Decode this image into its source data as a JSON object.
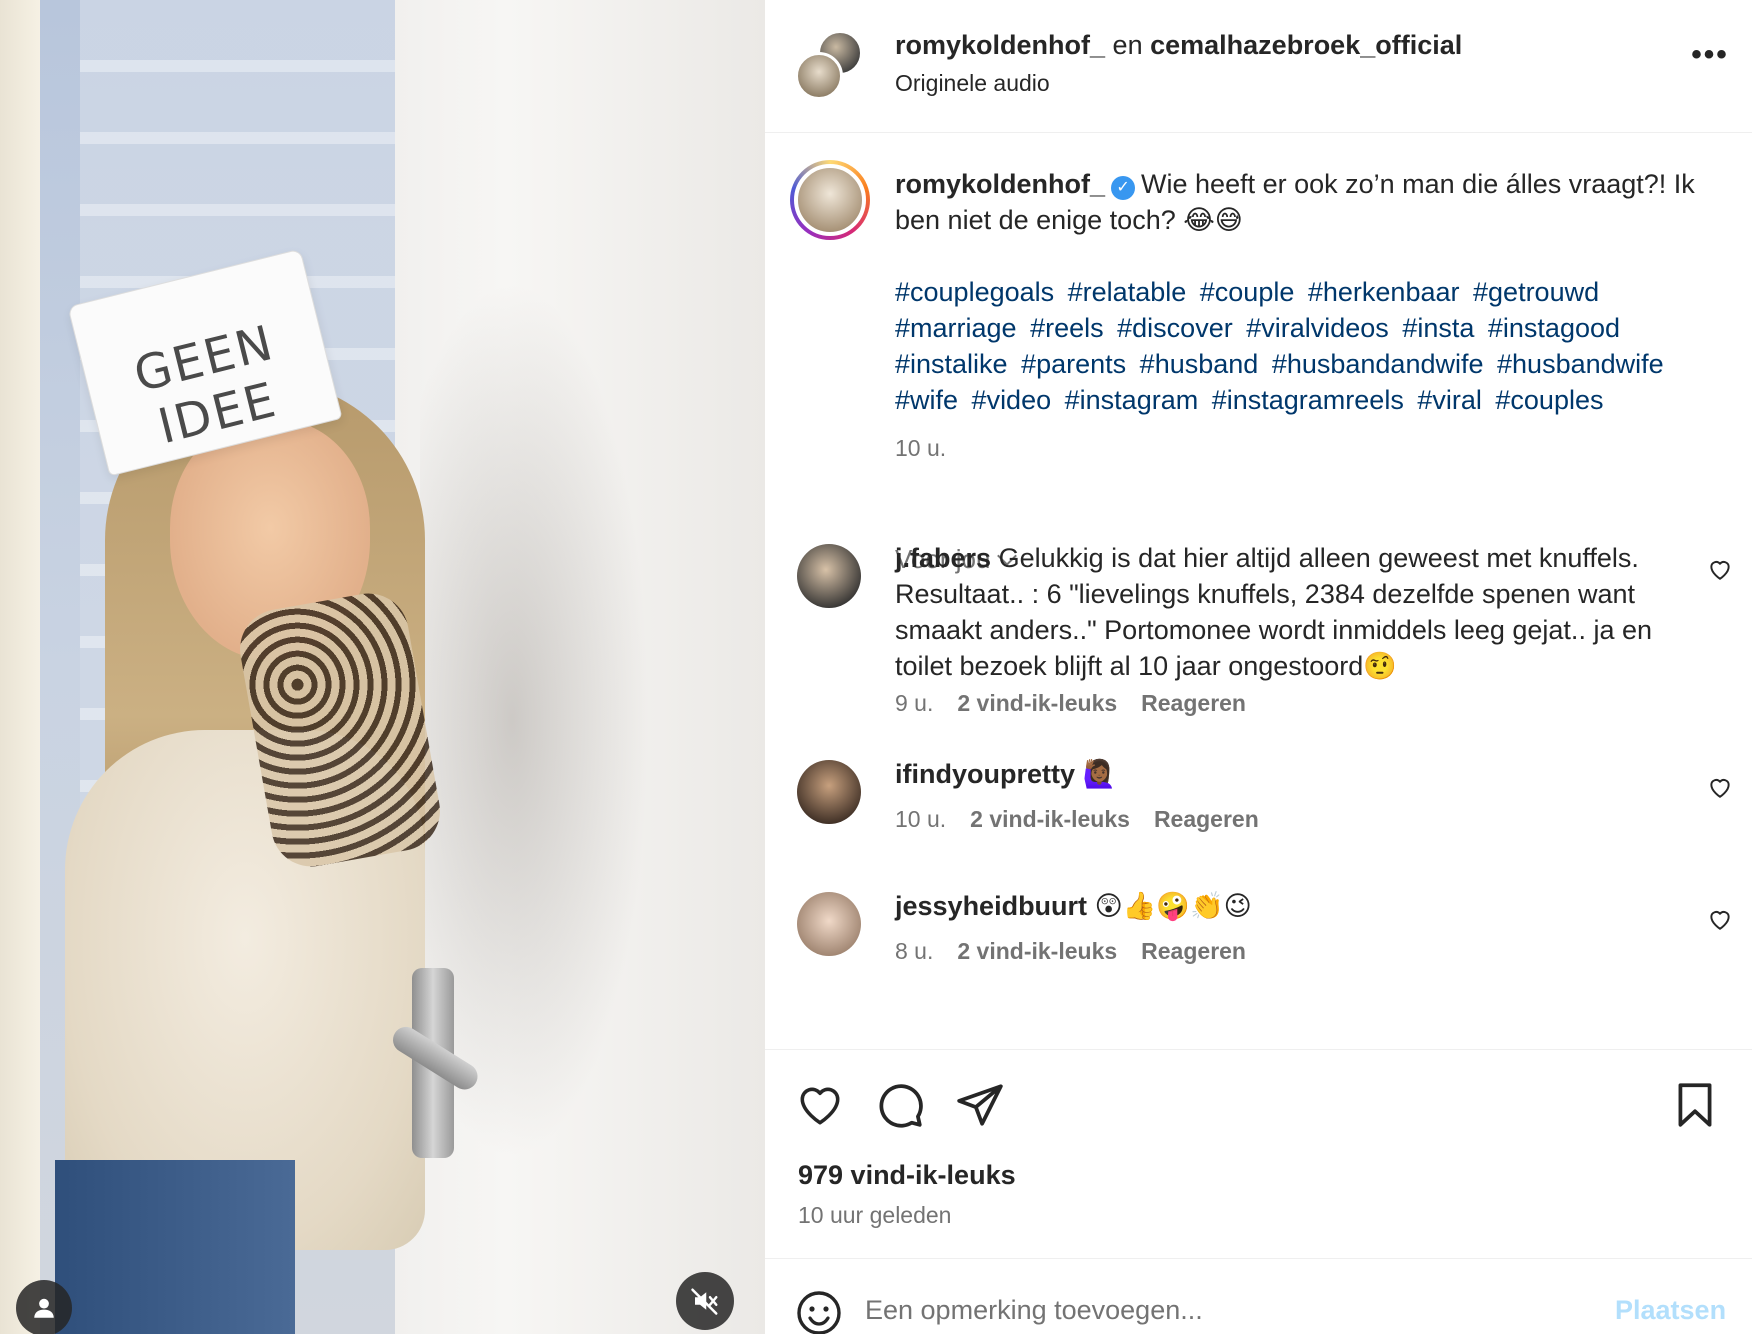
{
  "media": {
    "hat_text": "GEEN IDEE"
  },
  "header": {
    "user1": "romykoldenhof_",
    "separator": "en",
    "user2": "cemalhazebroek_official",
    "audio": "Originele audio",
    "more_label": "•••"
  },
  "caption": {
    "username": "romykoldenhof_",
    "verified_mark": "✓",
    "text": "Wie heeft er ook zo’n man die álles vraagt?! Ik ben niet de enige toch? 😂😅",
    "hashtags": [
      "#couplegoals",
      "#relatable",
      "#couple",
      "#herkenbaar",
      "#getrouwd",
      "#marriage",
      "#reels",
      "#discover",
      "#viralvideos",
      "#insta",
      "#instagood",
      "#instalike",
      "#parents",
      "#husband",
      "#husbandandwife",
      "#husbandwife",
      "#wife",
      "#video",
      "#instagram",
      "#instagramreels",
      "#viral",
      "#couples"
    ],
    "time": "10 u."
  },
  "sort_label": "Voor jou",
  "comments": [
    {
      "username": "j.fabers",
      "text": "Gelukkig is dat hier altijd alleen geweest met knuffels. Resultaat.. : 6 \"lievelings knuffels, 2384 dezelfde spenen want smaakt anders..\" Portomonee wordt inmiddels leeg gejat.. ja en toilet bezoek blijft al 10 jaar ongestoord🤨",
      "time": "9 u.",
      "likes": "2 vind-ik-leuks",
      "reply": "Reageren"
    },
    {
      "username": "ifindyoupretty",
      "text": "🙋🏾‍♀️",
      "time": "10 u.",
      "likes": "2 vind-ik-leuks",
      "reply": "Reageren"
    },
    {
      "username": "jessyheidbuurt",
      "text": "😲👍🤪👏😉",
      "time": "8 u.",
      "likes": "2 vind-ik-leuks",
      "reply": "Reageren"
    }
  ],
  "actions": {
    "icons": [
      "heart-icon",
      "comment-icon",
      "share-icon",
      "bookmark-icon"
    ],
    "likes": "979 vind-ik-leuks",
    "ago": "10 uur geleden"
  },
  "composer": {
    "placeholder": "Een opmerking toevoegen...",
    "post_label": "Plaatsen"
  },
  "colors": {
    "link": "#00376b",
    "secondary_text": "#737373",
    "post_disabled": "#b2dffc",
    "verified": "#3897f0"
  }
}
